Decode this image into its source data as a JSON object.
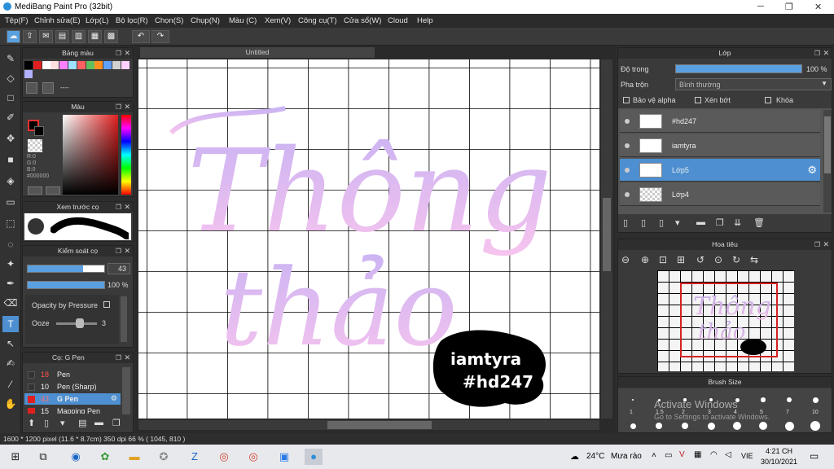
{
  "window": {
    "title": "MediBang Paint Pro (32bit)"
  },
  "menu": [
    "Tệp(F)",
    "Chỉnh sửa(E)",
    "Lớp(L)",
    "Bộ lọc(R)",
    "Chọn(S)",
    "Chụp(N)",
    "Màu (C)",
    "Xem(V)",
    "Công cụ(T)",
    "Cửa sổ(W)",
    "Cloud",
    "Help"
  ],
  "canvas": {
    "tab_title": "Untitled",
    "title_line1": "Thông",
    "title_line2": "thảo",
    "sticker_line1": "iamtyra",
    "sticker_line2": "#hd247"
  },
  "palette_panel": {
    "title": "Bảng màu",
    "name_field": "----"
  },
  "color_panel": {
    "title": "Màu",
    "r": "R:0",
    "g": "G:0",
    "b": "B:0",
    "hex": "#000000"
  },
  "preview_panel": {
    "title": "Xem trước cọ"
  },
  "brush_control": {
    "title": "Kiểm soát cọ",
    "size_value": "43",
    "opacity_value": "100 %",
    "size_fraction": 0.72,
    "opacity_fraction": 1.0,
    "opacity_by_pressure": "Opacity by Pressure",
    "ooze_label": "Ooze",
    "ooze_value": "3"
  },
  "brush_list": {
    "title": "Cọ: G Pen",
    "items": [
      {
        "size": "18",
        "name": "Pen",
        "color": "#ff4040"
      },
      {
        "size": "10",
        "name": "Pen (Sharp)",
        "color": "#ff4040"
      },
      {
        "size": "43",
        "name": "G Pen",
        "color": "#ff4040",
        "selected": true
      },
      {
        "size": "15",
        "name": "Mapping Pen",
        "color": "#ff4040"
      }
    ]
  },
  "layer_panel": {
    "title": "Lớp",
    "opacity_label": "Độ trong",
    "opacity_value": "100 %",
    "opacity_fraction": 1.0,
    "blend_label": "Pha trộn",
    "blend_value": "Bình thường",
    "protect_alpha": "Bảo vệ alpha",
    "clipping": "Xén bớt",
    "lock": "Khóa",
    "layers": [
      {
        "name": "#hd247",
        "selected": false
      },
      {
        "name": "iamtyra",
        "selected": false
      },
      {
        "name": "Lớp5",
        "selected": true
      },
      {
        "name": "Lớp4",
        "selected": false
      }
    ]
  },
  "navigator": {
    "title": "Hoa tiêu"
  },
  "brush_size": {
    "title": "Brush Size",
    "labels": [
      "1",
      "1.5",
      "2",
      "3",
      "4",
      "5",
      "7",
      "10"
    ]
  },
  "watermark": {
    "line1": "Activate Windows",
    "line2": "Go to Settings to activate Windows."
  },
  "status": {
    "text": "1600 * 1200 pixel  (11.6 * 8.7cm)  350 dpi  66 %  ( 1045, 810 )"
  },
  "taskbar": {
    "weather_temp": "24°C",
    "weather_text": "Mưa rào",
    "lang": "VIE",
    "time": "4:21 CH",
    "date": "30/10/2021"
  },
  "colors": {
    "gradient_top": "#c9b3f3",
    "gradient_bottom": "#f7c4ee",
    "selection": "#4d8fd0"
  }
}
